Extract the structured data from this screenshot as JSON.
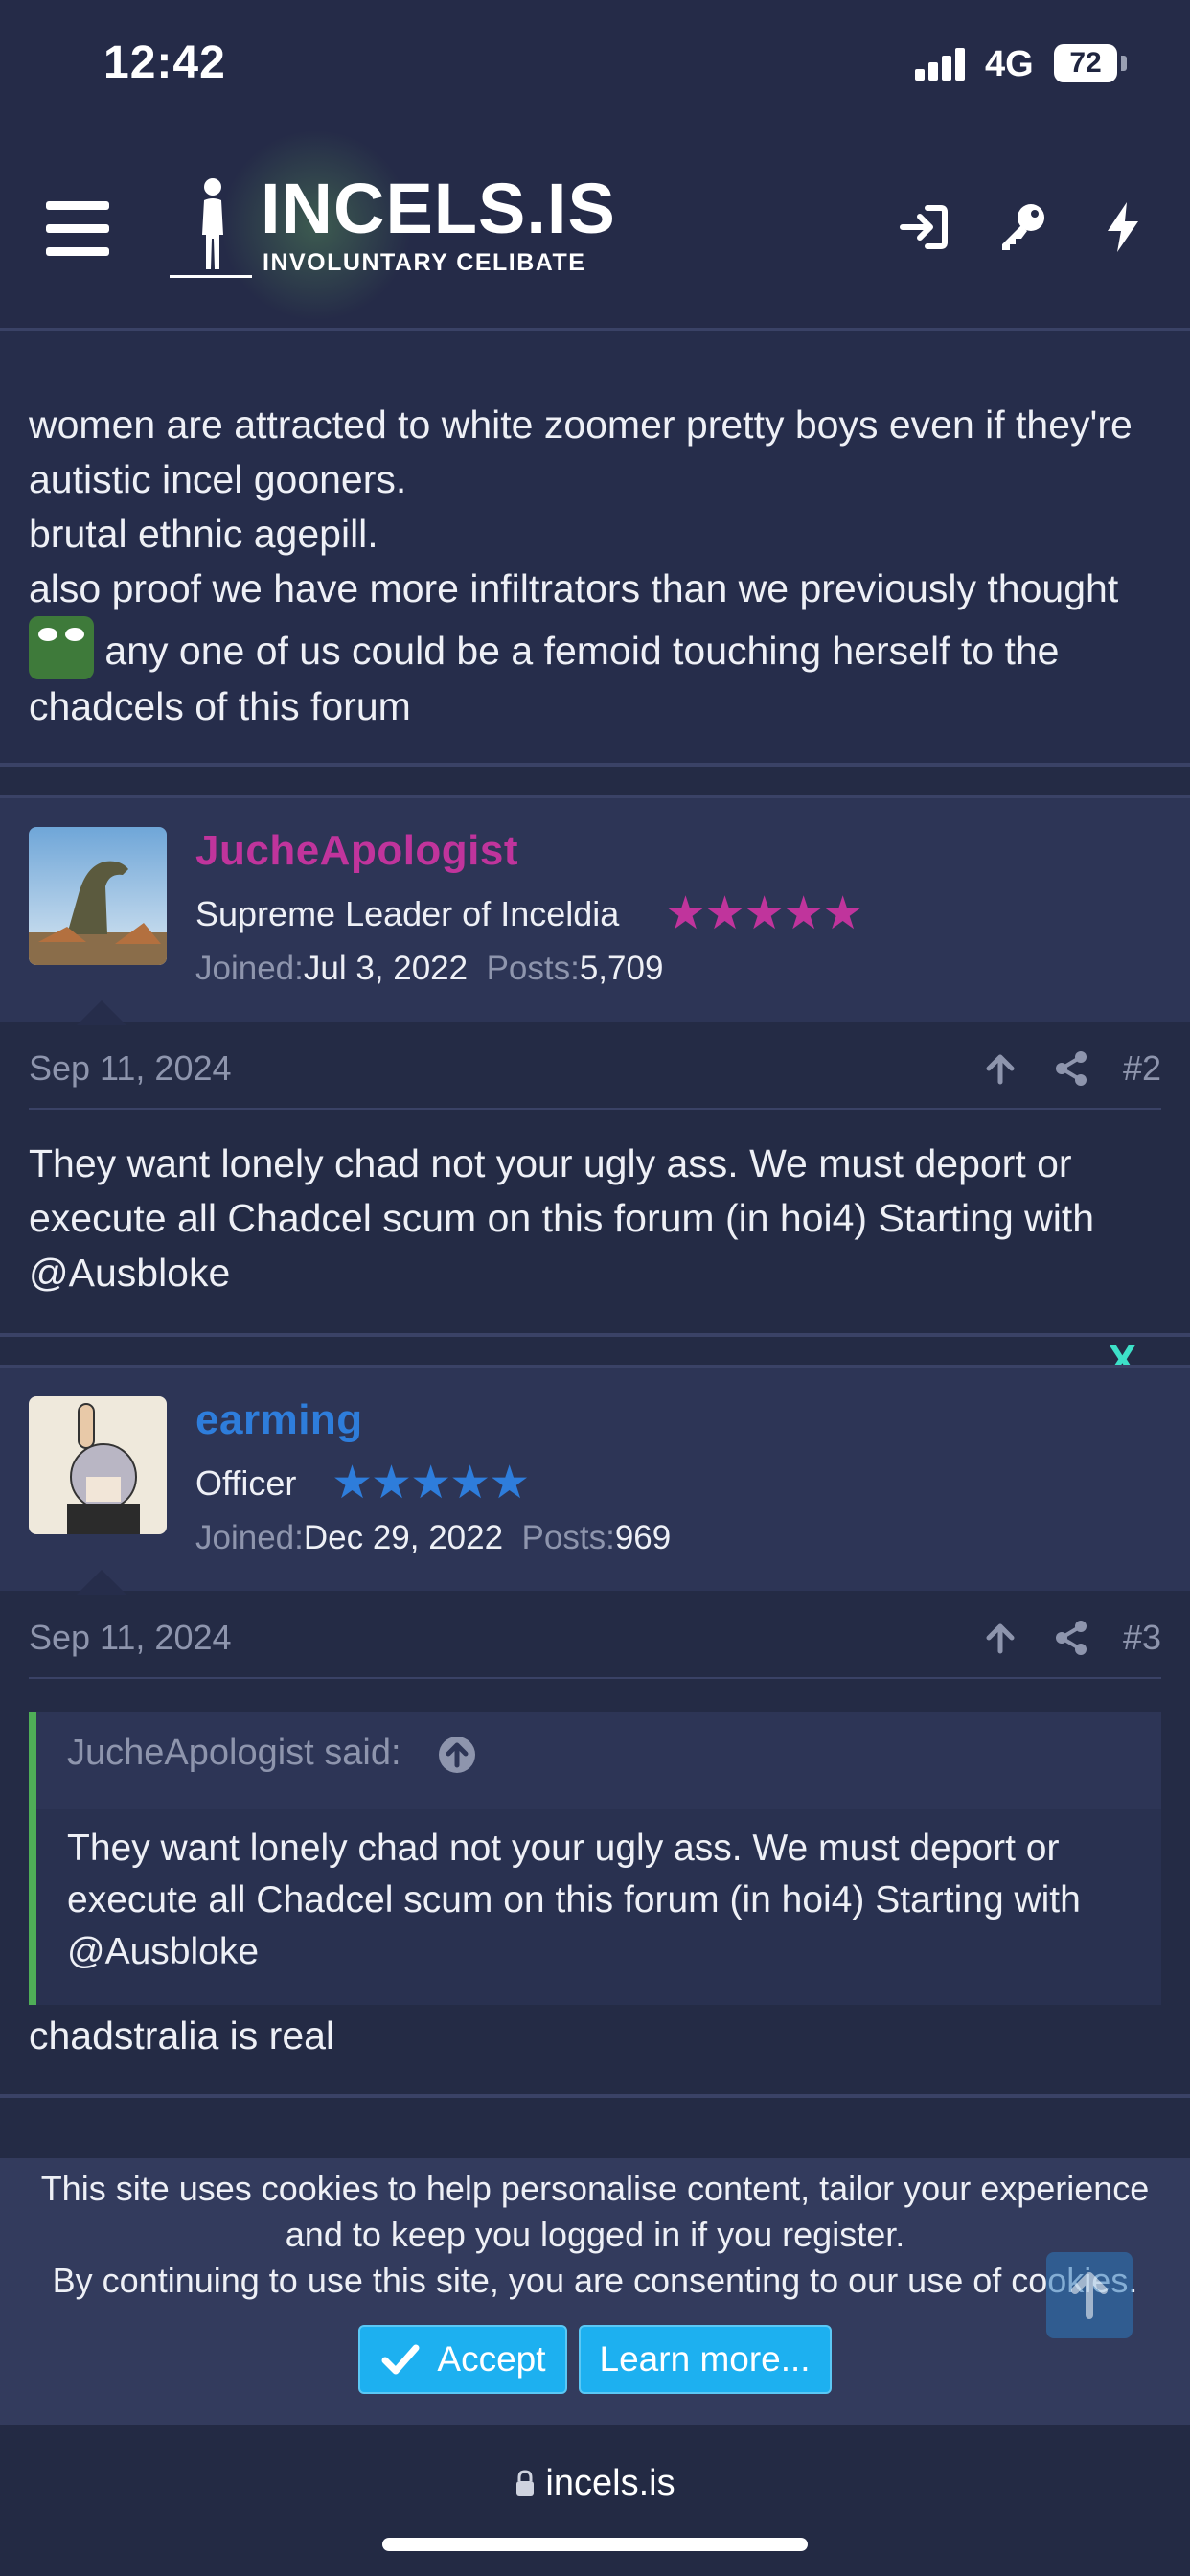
{
  "status_bar": {
    "time": "12:42",
    "network": "4G",
    "battery": "72"
  },
  "header": {
    "logo_title": "INCELS.IS",
    "logo_subtitle": "INVOLUNTARY CELIBATE",
    "icons": [
      "menu-icon",
      "login-icon",
      "key-icon",
      "lightning-icon"
    ]
  },
  "previous_post": {
    "lines": [
      "women are attracted to white zoomer pretty boys even if they're autistic incel gooners.",
      "brutal ethnic agepill.",
      "also proof we have more infiltrators than we previously thought",
      "any one of us could be a femoid touching herself to the chadcels of this forum"
    ],
    "emoji": "pepe-emoji"
  },
  "posts": [
    {
      "username": "JucheApologist",
      "username_color": "#c0349c",
      "user_title": "Supreme Leader of Inceldia",
      "stars": "★★★★★",
      "stars_color": "#c0349c",
      "joined_label": "Joined:",
      "joined": "Jul 3, 2022",
      "posts_label": "Posts:",
      "posts": "5,709",
      "date": "Sep 11, 2024",
      "number": "#2",
      "body": "They want lonely chad not your ugly ass. We must deport or execute all Chadcel scum on this forum (in hoi4) Starting with @Ausbloke"
    },
    {
      "username": "earming",
      "username_color": "#2e7ddb",
      "user_title": "Officer",
      "stars": "★★★★★",
      "stars_color": "#2e7ddb",
      "joined_label": "Joined:",
      "joined": "Dec 29, 2022",
      "posts_label": "Posts:",
      "posts": "969",
      "date": "Sep 11, 2024",
      "number": "#3",
      "quote_author": "JucheApologist said:",
      "quote_body": "They want lonely chad not your ugly ass. We must deport or execute all Chadcel scum on this forum (in hoi4) Starting with @Ausbloke",
      "body": "chadstralia is real"
    }
  ],
  "ad": {
    "close_label": "X"
  },
  "cookie_notice": {
    "text_line1": "This site uses cookies to help personalise content, tailor your experience and to keep you logged in if you register.",
    "text_line2": "By continuing to use this site, you are consenting to our use of cookies.",
    "accept_label": "Accept",
    "learn_more_label": "Learn more..."
  },
  "url_bar": {
    "url": "incels.is"
  }
}
